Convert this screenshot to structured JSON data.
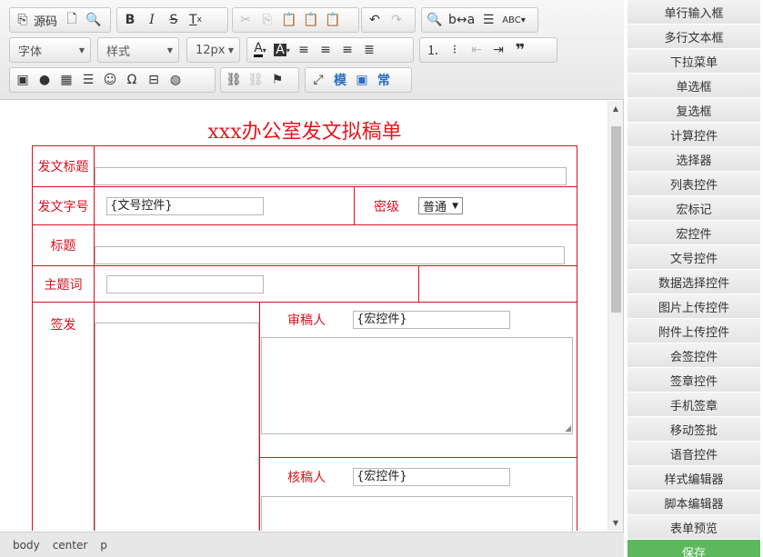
{
  "toolbar": {
    "source_label": "源码",
    "font_label": "字体",
    "style_label": "样式",
    "size_label": "12px",
    "mold_label": "模",
    "common_label": "常"
  },
  "form": {
    "title": "xxx办公室发文拟稿单",
    "row_title_label": "发文标题",
    "row_docno_label": "发文字号",
    "docno_value": "{文号控件}",
    "secret_label": "密级",
    "secret_value": "普通",
    "subject_label": "标题",
    "keywords_label": "主题词",
    "sign_label": "签发",
    "reviewer_label": "审稿人",
    "reviewer_value": "{宏控件}",
    "checker_label": "核稿人",
    "checker_value": "{宏控件}"
  },
  "statusbar": {
    "path": [
      "body",
      "center",
      "p"
    ]
  },
  "controls": [
    "单行输入框",
    "多行文本框",
    "下拉菜单",
    "单选框",
    "复选框",
    "计算控件",
    "选择器",
    "列表控件",
    "宏标记",
    "宏控件",
    "文号控件",
    "数据选择控件",
    "图片上传控件",
    "附件上传控件",
    "会签控件",
    "签章控件",
    "手机签章",
    "移动签批",
    "语音控件",
    "样式编辑器",
    "脚本编辑器",
    "表单预览",
    "保存"
  ],
  "colors": {
    "form_red": "#d8131f",
    "save_green": "#5cb85c",
    "toolbar_bg": "#e6e6e6"
  }
}
